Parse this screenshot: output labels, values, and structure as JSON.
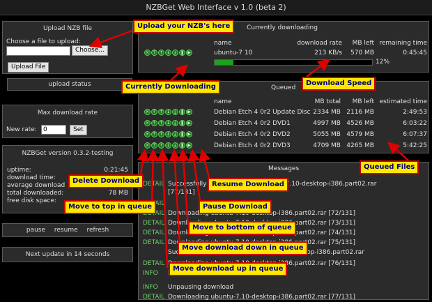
{
  "app": {
    "title": "NZBGet Web Interface v 1.0 (beta 2)"
  },
  "upload": {
    "title": "Upload NZB file",
    "prompt": "Choose a file to upload:",
    "choose_label": "Choose...",
    "submit_label": "Upload File",
    "status": "upload status",
    "file_value": ""
  },
  "rate": {
    "title": "Max download rate",
    "label": "New rate:",
    "value": "0",
    "set_label": "Set"
  },
  "info": {
    "version": "NZBGet version 0.3.2-testing",
    "rows": [
      {
        "label": "uptime:",
        "value": "0:21:45"
      },
      {
        "label": "download time:",
        "value": ""
      },
      {
        "label": "average download",
        "value": ""
      },
      {
        "label": "total downloaded:",
        "value": "78 MB"
      },
      {
        "label": "free disk space:",
        "value": ""
      }
    ]
  },
  "actions": {
    "pause": "pause",
    "resume": "resume",
    "refresh": "refresh"
  },
  "next_update": "Next update in 14 seconds",
  "current": {
    "title": "Currently downloading",
    "headers": {
      "name": "name",
      "rate": "download rate",
      "left": "MB left",
      "remaining": "remaining time"
    },
    "item": {
      "name": "ubuntu-7 10",
      "rate": "213 KB/s",
      "left": "570 MB",
      "remaining": "0:45:45",
      "progress_label": "12%",
      "progress": 0.12
    }
  },
  "queued": {
    "title": "Queued",
    "headers": {
      "name": "name",
      "total": "MB total",
      "left": "MB left",
      "estimated": "estimated time"
    },
    "items": [
      {
        "name": "Debian Etch 4 0r2 Update Disc",
        "total": "2334 MB",
        "left": "2116 MB",
        "time": "2:49:53"
      },
      {
        "name": "Debian Etch 4 0r2 DVD1",
        "total": "4997 MB",
        "left": "4526 MB",
        "time": "6:03:22"
      },
      {
        "name": "Debian Etch 4 0r2 DVD2",
        "total": "5055 MB",
        "left": "4579 MB",
        "time": "6:07:37"
      },
      {
        "name": "Debian Etch 4 0r2 DVD3",
        "total": "4709 MB",
        "left": "4265 MB",
        "time": "5:42:25"
      }
    ]
  },
  "messages": {
    "title": "Messages",
    "items": [
      {
        "type": "DETAIL",
        "text": "Successfully downloaded \\10\\ubuntu-7.10-desktop-i386.part02.rar"
      },
      {
        "type": "",
        "text": "[77/131]"
      },
      {
        "type": "DETAIL",
        "text": ""
      },
      {
        "type": "DETAIL",
        "text": "Downloading ubuntu-7.10-desktop-i386.part02.rar [72/131]"
      },
      {
        "type": "DETAIL",
        "text": "Downloading ubuntu-7.10-desktop-i386.part02.rar [73/131]"
      },
      {
        "type": "DETAIL",
        "text": "Downloading ubuntu-7.10-desktop-i386.part02.rar [74/131]"
      },
      {
        "type": "DETAIL",
        "text": "Downloading ubuntu-7.10-desktop-i386.part02.rar [75/131]"
      },
      {
        "type": "",
        "text": "Successfully downloaded ubuntu-7.10-desktop-i386.part02.rar"
      },
      {
        "type": "DETAIL",
        "text": "Downloading ubuntu-7.10-desktop-i386.part02.rar [76/131]"
      },
      {
        "type": "INFO",
        "text": "Pausing download"
      },
      {
        "type": "INFO",
        "text": "Unpausing download"
      },
      {
        "type": "DETAIL",
        "text": "Downloading ubuntu-7.10-desktop-i386.part02.rar [77/131]"
      }
    ]
  },
  "annotations": {
    "upload": "Upload your NZB's here",
    "current": "Currently Downloading",
    "speed": "Download Speed",
    "queued": "Queued Files",
    "delete": "Delete Download",
    "top": "Move to top in queue",
    "resume": "Resume Download",
    "pause": "Pause Download",
    "bottom": "Move to bottom of queue",
    "down": "Move download down in queue",
    "up": "Move download up in queue"
  },
  "colors": {
    "accent_green": "#1fa01f",
    "note_bg": "#ffe800",
    "note_border": "#cc0000",
    "arrow": "#e00000"
  }
}
